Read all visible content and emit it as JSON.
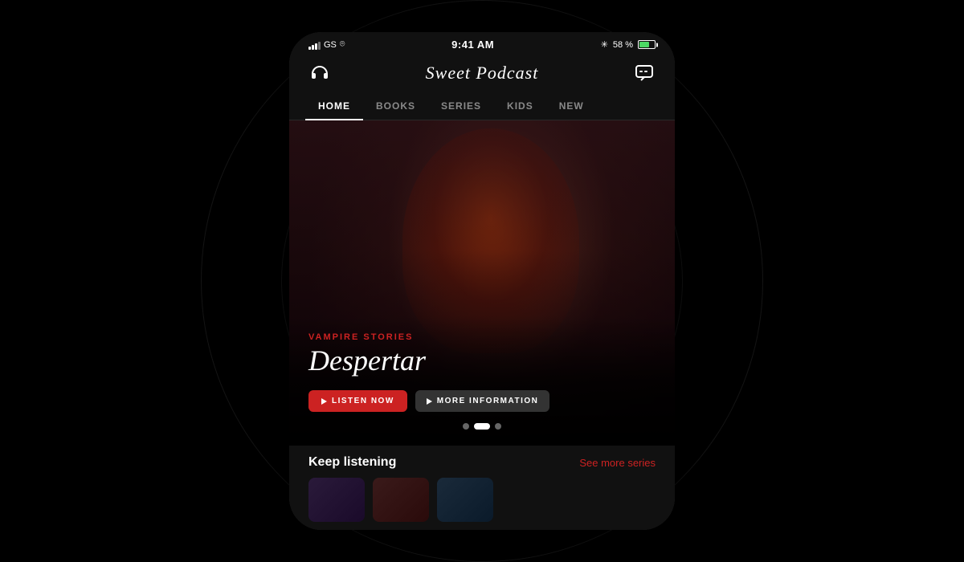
{
  "background": {
    "color": "#000000"
  },
  "statusBar": {
    "carrier": "GS",
    "time": "9:41 AM",
    "bluetooth": "58 %"
  },
  "header": {
    "title": "Sweet Podcast",
    "headphones_icon": "headphones",
    "chat_icon": "chat-bubble"
  },
  "nav": {
    "tabs": [
      {
        "label": "HOME",
        "active": true
      },
      {
        "label": "BOOKS",
        "active": false
      },
      {
        "label": "SERIES",
        "active": false
      },
      {
        "label": "KIDS",
        "active": false
      },
      {
        "label": "NEW",
        "active": false
      }
    ]
  },
  "hero": {
    "series_name": "VAMPIRE STORIES",
    "episode_title": "Despertar",
    "listen_button": "LISTEN NOW",
    "more_button": "MORE INFORMATION",
    "dots": [
      {
        "active": false
      },
      {
        "active": true
      },
      {
        "active": false
      }
    ]
  },
  "keepListening": {
    "title": "Keep listening",
    "see_more": "See more series"
  }
}
